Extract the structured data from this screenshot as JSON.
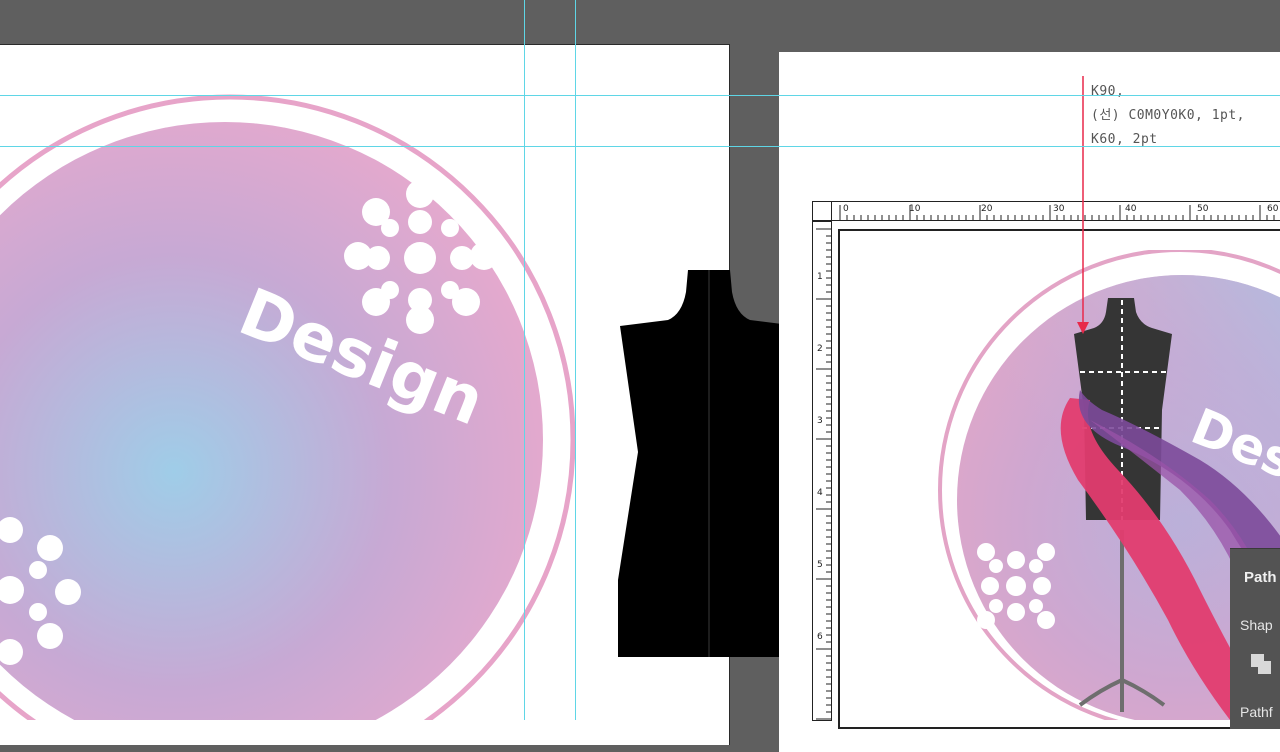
{
  "canvas": {
    "pasteboard_color": "#5f5f5f",
    "guide_color": "#5fd6e6"
  },
  "logo_left": {
    "word": "Design",
    "gradient_center": "#9fcde8",
    "gradient_mid": "#c7a9d4",
    "gradient_edge": "#e7a9cd",
    "ring_color": "#e7a4c9"
  },
  "dress_form": {
    "fill": "#000000"
  },
  "annotation": {
    "line_color": "#e8294a",
    "lines": [
      "K90,",
      "(선) C0M0Y0K0, 1pt,",
      "K60, 2pt"
    ]
  },
  "ruler_top": {
    "labels": [
      "0",
      "10",
      "20",
      "30",
      "40",
      "50",
      "60"
    ]
  },
  "ruler_left": {
    "labels": [
      "1",
      "2",
      "3",
      "4",
      "5",
      "6"
    ]
  },
  "logo_right": {
    "word": "Des",
    "ribbon_colors": [
      "#e23c6f",
      "#7c4a9a",
      "#9a53a8"
    ]
  },
  "path_panel": {
    "title": "Path",
    "shape_label": "Shap",
    "pathfinder_label": "Pathf",
    "icon": "unite-shape-icon"
  }
}
